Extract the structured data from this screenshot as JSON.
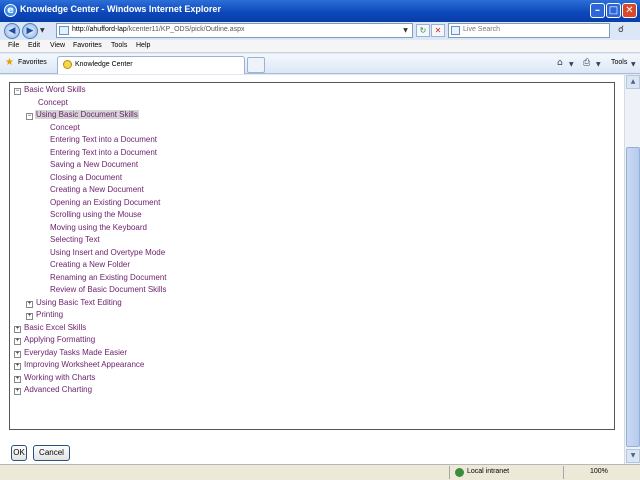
{
  "window": {
    "title": "Knowledge Center - Windows Internet Explorer",
    "minimize": "–",
    "maximize": "□",
    "close": "✕"
  },
  "address_bar": {
    "url_host": "http://ahufford-lap",
    "url_path": "/kcenter11/KP_ODS/pick/Outline.aspx",
    "search_placeholder": "Live Search"
  },
  "menu": [
    "File",
    "Edit",
    "View",
    "Favorites",
    "Tools",
    "Help"
  ],
  "favorites_bar": {
    "favorites_label": "Favorites",
    "tab_label": "Knowledge Center",
    "tools_label": "Tools"
  },
  "tree": [
    {
      "label": "Basic Word Skills",
      "level": 0,
      "toggle": "−"
    },
    {
      "label": "Concept",
      "level": 1,
      "toggle": ""
    },
    {
      "label": "Using Basic Document Skills",
      "level": 1,
      "toggle": "−",
      "selected": true
    },
    {
      "label": "Concept",
      "level": 2,
      "toggle": ""
    },
    {
      "label": "Entering Text into a Document",
      "level": 2,
      "toggle": ""
    },
    {
      "label": "Entering Text into a Document",
      "level": 2,
      "toggle": ""
    },
    {
      "label": "Saving a New Document",
      "level": 2,
      "toggle": ""
    },
    {
      "label": "Closing a Document",
      "level": 2,
      "toggle": ""
    },
    {
      "label": "Creating a New Document",
      "level": 2,
      "toggle": ""
    },
    {
      "label": "Opening an Existing Document",
      "level": 2,
      "toggle": ""
    },
    {
      "label": "Scrolling using the Mouse",
      "level": 2,
      "toggle": ""
    },
    {
      "label": "Moving using the Keyboard",
      "level": 2,
      "toggle": ""
    },
    {
      "label": "Selecting Text",
      "level": 2,
      "toggle": ""
    },
    {
      "label": "Using Insert and Overtype Mode",
      "level": 2,
      "toggle": ""
    },
    {
      "label": "Creating a New Folder",
      "level": 2,
      "toggle": ""
    },
    {
      "label": "Renaming an Existing Document",
      "level": 2,
      "toggle": ""
    },
    {
      "label": "Review of Basic Document Skills",
      "level": 2,
      "toggle": ""
    },
    {
      "label": "Using Basic Text Editing",
      "level": 1,
      "toggle": "+"
    },
    {
      "label": "Printing",
      "level": 1,
      "toggle": "+"
    },
    {
      "label": "Basic Excel Skills",
      "level": 0,
      "toggle": "+"
    },
    {
      "label": "Applying Formatting",
      "level": 0,
      "toggle": "+"
    },
    {
      "label": "Everyday Tasks Made Easier",
      "level": 0,
      "toggle": "+"
    },
    {
      "label": "Improving Worksheet Appearance",
      "level": 0,
      "toggle": "+"
    },
    {
      "label": "Working with Charts",
      "level": 0,
      "toggle": "+"
    },
    {
      "label": "Advanced Charting",
      "level": 0,
      "toggle": "+"
    }
  ],
  "buttons": {
    "ok": "OK",
    "cancel": "Cancel"
  },
  "status": {
    "zone": "Local intranet",
    "zoom": "100%"
  }
}
